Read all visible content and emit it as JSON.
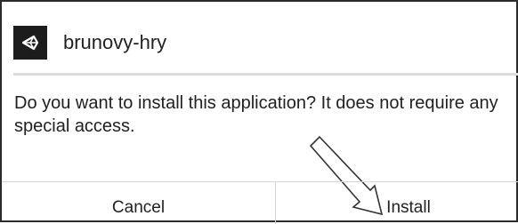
{
  "dialog": {
    "app_icon": "unity-logo-icon",
    "app_name": "brunovy-hry",
    "message": "Do you want to install this application? It does not require any special access.",
    "cancel_label": "Cancel",
    "install_label": "Install"
  },
  "annotation": {
    "icon": "pointer-arrow-icon"
  }
}
